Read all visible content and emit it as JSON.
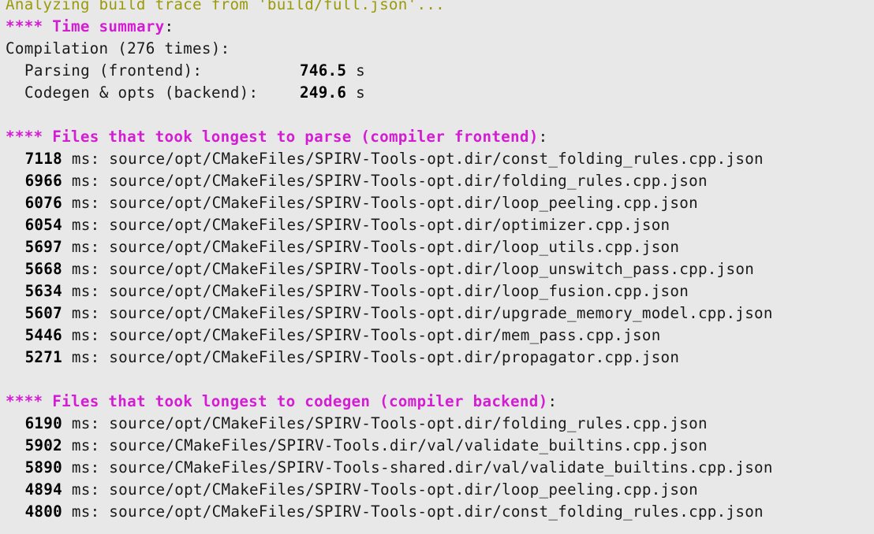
{
  "colors": {
    "background": "#e8e8e8",
    "text": "#1a1a1a",
    "olive": "#9a9a0a",
    "magenta": "#d31dd3"
  },
  "analyzing_line": "Analyzing build trace from 'build/full.json'...",
  "time_summary": {
    "stars": "****",
    "title": "Time summary",
    "colon": ":",
    "compilation_line": "Compilation (276 times):",
    "rows": [
      {
        "label": "Parsing (frontend):",
        "value": "746.5",
        "unit": "s"
      },
      {
        "label": "Codegen & opts (backend):",
        "value": "249.6",
        "unit": "s"
      }
    ]
  },
  "parse_section": {
    "stars": "****",
    "title": "Files that took longest to parse (compiler frontend)",
    "colon": ":",
    "ms_label": "ms:",
    "rows": [
      {
        "ms": "7118",
        "path": "source/opt/CMakeFiles/SPIRV-Tools-opt.dir/const_folding_rules.cpp.json"
      },
      {
        "ms": "6966",
        "path": "source/opt/CMakeFiles/SPIRV-Tools-opt.dir/folding_rules.cpp.json"
      },
      {
        "ms": "6076",
        "path": "source/opt/CMakeFiles/SPIRV-Tools-opt.dir/loop_peeling.cpp.json"
      },
      {
        "ms": "6054",
        "path": "source/opt/CMakeFiles/SPIRV-Tools-opt.dir/optimizer.cpp.json"
      },
      {
        "ms": "5697",
        "path": "source/opt/CMakeFiles/SPIRV-Tools-opt.dir/loop_utils.cpp.json"
      },
      {
        "ms": "5668",
        "path": "source/opt/CMakeFiles/SPIRV-Tools-opt.dir/loop_unswitch_pass.cpp.json"
      },
      {
        "ms": "5634",
        "path": "source/opt/CMakeFiles/SPIRV-Tools-opt.dir/loop_fusion.cpp.json"
      },
      {
        "ms": "5607",
        "path": "source/opt/CMakeFiles/SPIRV-Tools-opt.dir/upgrade_memory_model.cpp.json"
      },
      {
        "ms": "5446",
        "path": "source/opt/CMakeFiles/SPIRV-Tools-opt.dir/mem_pass.cpp.json"
      },
      {
        "ms": "5271",
        "path": "source/opt/CMakeFiles/SPIRV-Tools-opt.dir/propagator.cpp.json"
      }
    ]
  },
  "codegen_section": {
    "stars": "****",
    "title": "Files that took longest to codegen (compiler backend)",
    "colon": ":",
    "ms_label": "ms:",
    "rows": [
      {
        "ms": "6190",
        "path": "source/opt/CMakeFiles/SPIRV-Tools-opt.dir/folding_rules.cpp.json"
      },
      {
        "ms": "5902",
        "path": "source/CMakeFiles/SPIRV-Tools.dir/val/validate_builtins.cpp.json"
      },
      {
        "ms": "5890",
        "path": "source/CMakeFiles/SPIRV-Tools-shared.dir/val/validate_builtins.cpp.json"
      },
      {
        "ms": "4894",
        "path": "source/opt/CMakeFiles/SPIRV-Tools-opt.dir/loop_peeling.cpp.json"
      },
      {
        "ms": "4800",
        "path": "source/opt/CMakeFiles/SPIRV-Tools-opt.dir/const_folding_rules.cpp.json"
      }
    ]
  }
}
